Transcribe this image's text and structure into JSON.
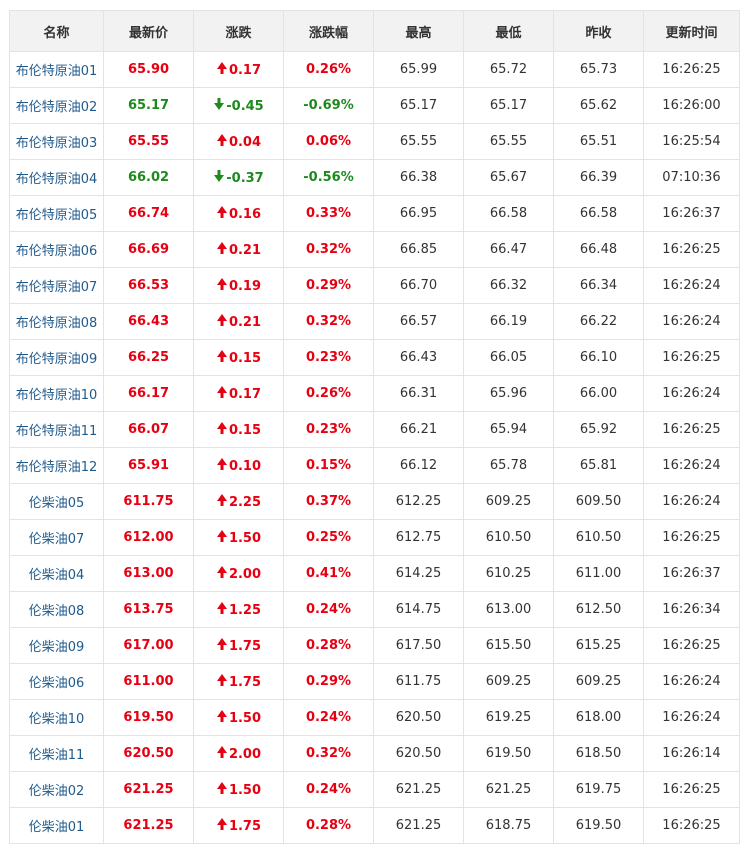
{
  "table": {
    "headers": [
      "名称",
      "最新价",
      "涨跌",
      "涨跌幅",
      "最高",
      "最低",
      "昨收",
      "更新时间"
    ],
    "rows": [
      {
        "name": "布伦特原油01",
        "last": "65.90",
        "change": "0.17",
        "pct": "0.26%",
        "high": "65.99",
        "low": "65.72",
        "prev": "65.73",
        "time": "16:26:25",
        "dir": "up"
      },
      {
        "name": "布伦特原油02",
        "last": "65.17",
        "change": "-0.45",
        "pct": "-0.69%",
        "high": "65.17",
        "low": "65.17",
        "prev": "65.62",
        "time": "16:26:00",
        "dir": "down"
      },
      {
        "name": "布伦特原油03",
        "last": "65.55",
        "change": "0.04",
        "pct": "0.06%",
        "high": "65.55",
        "low": "65.55",
        "prev": "65.51",
        "time": "16:25:54",
        "dir": "up"
      },
      {
        "name": "布伦特原油04",
        "last": "66.02",
        "change": "-0.37",
        "pct": "-0.56%",
        "high": "66.38",
        "low": "65.67",
        "prev": "66.39",
        "time": "07:10:36",
        "dir": "down"
      },
      {
        "name": "布伦特原油05",
        "last": "66.74",
        "change": "0.16",
        "pct": "0.33%",
        "high": "66.95",
        "low": "66.58",
        "prev": "66.58",
        "time": "16:26:37",
        "dir": "up"
      },
      {
        "name": "布伦特原油06",
        "last": "66.69",
        "change": "0.21",
        "pct": "0.32%",
        "high": "66.85",
        "low": "66.47",
        "prev": "66.48",
        "time": "16:26:25",
        "dir": "up"
      },
      {
        "name": "布伦特原油07",
        "last": "66.53",
        "change": "0.19",
        "pct": "0.29%",
        "high": "66.70",
        "low": "66.32",
        "prev": "66.34",
        "time": "16:26:24",
        "dir": "up"
      },
      {
        "name": "布伦特原油08",
        "last": "66.43",
        "change": "0.21",
        "pct": "0.32%",
        "high": "66.57",
        "low": "66.19",
        "prev": "66.22",
        "time": "16:26:24",
        "dir": "up"
      },
      {
        "name": "布伦特原油09",
        "last": "66.25",
        "change": "0.15",
        "pct": "0.23%",
        "high": "66.43",
        "low": "66.05",
        "prev": "66.10",
        "time": "16:26:25",
        "dir": "up"
      },
      {
        "name": "布伦特原油10",
        "last": "66.17",
        "change": "0.17",
        "pct": "0.26%",
        "high": "66.31",
        "low": "65.96",
        "prev": "66.00",
        "time": "16:26:24",
        "dir": "up"
      },
      {
        "name": "布伦特原油11",
        "last": "66.07",
        "change": "0.15",
        "pct": "0.23%",
        "high": "66.21",
        "low": "65.94",
        "prev": "65.92",
        "time": "16:26:25",
        "dir": "up"
      },
      {
        "name": "布伦特原油12",
        "last": "65.91",
        "change": "0.10",
        "pct": "0.15%",
        "high": "66.12",
        "low": "65.78",
        "prev": "65.81",
        "time": "16:26:24",
        "dir": "up"
      },
      {
        "name": "伦柴油05",
        "last": "611.75",
        "change": "2.25",
        "pct": "0.37%",
        "high": "612.25",
        "low": "609.25",
        "prev": "609.50",
        "time": "16:26:24",
        "dir": "up"
      },
      {
        "name": "伦柴油07",
        "last": "612.00",
        "change": "1.50",
        "pct": "0.25%",
        "high": "612.75",
        "low": "610.50",
        "prev": "610.50",
        "time": "16:26:25",
        "dir": "up"
      },
      {
        "name": "伦柴油04",
        "last": "613.00",
        "change": "2.00",
        "pct": "0.41%",
        "high": "614.25",
        "low": "610.25",
        "prev": "611.00",
        "time": "16:26:37",
        "dir": "up"
      },
      {
        "name": "伦柴油08",
        "last": "613.75",
        "change": "1.25",
        "pct": "0.24%",
        "high": "614.75",
        "low": "613.00",
        "prev": "612.50",
        "time": "16:26:34",
        "dir": "up"
      },
      {
        "name": "伦柴油09",
        "last": "617.00",
        "change": "1.75",
        "pct": "0.28%",
        "high": "617.50",
        "low": "615.50",
        "prev": "615.25",
        "time": "16:26:25",
        "dir": "up"
      },
      {
        "name": "伦柴油06",
        "last": "611.00",
        "change": "1.75",
        "pct": "0.29%",
        "high": "611.75",
        "low": "609.25",
        "prev": "609.25",
        "time": "16:26:24",
        "dir": "up"
      },
      {
        "name": "伦柴油10",
        "last": "619.50",
        "change": "1.50",
        "pct": "0.24%",
        "high": "620.50",
        "low": "619.25",
        "prev": "618.00",
        "time": "16:26:24",
        "dir": "up"
      },
      {
        "name": "伦柴油11",
        "last": "620.50",
        "change": "2.00",
        "pct": "0.32%",
        "high": "620.50",
        "low": "619.50",
        "prev": "618.50",
        "time": "16:26:14",
        "dir": "up"
      },
      {
        "name": "伦柴油02",
        "last": "621.25",
        "change": "1.50",
        "pct": "0.24%",
        "high": "621.25",
        "low": "621.25",
        "prev": "619.75",
        "time": "16:26:25",
        "dir": "up"
      },
      {
        "name": "伦柴油01",
        "last": "621.25",
        "change": "1.75",
        "pct": "0.28%",
        "high": "621.25",
        "low": "618.75",
        "prev": "619.50",
        "time": "16:26:25",
        "dir": "up"
      }
    ]
  },
  "colors": {
    "up": "#e60012",
    "down": "#1e8a1e",
    "name_link": "#1f5a8c",
    "header_bg": "#f2f2f2",
    "border": "#e3e3e3"
  },
  "icons": {
    "up": "arrow-up-icon",
    "down": "arrow-down-icon"
  }
}
